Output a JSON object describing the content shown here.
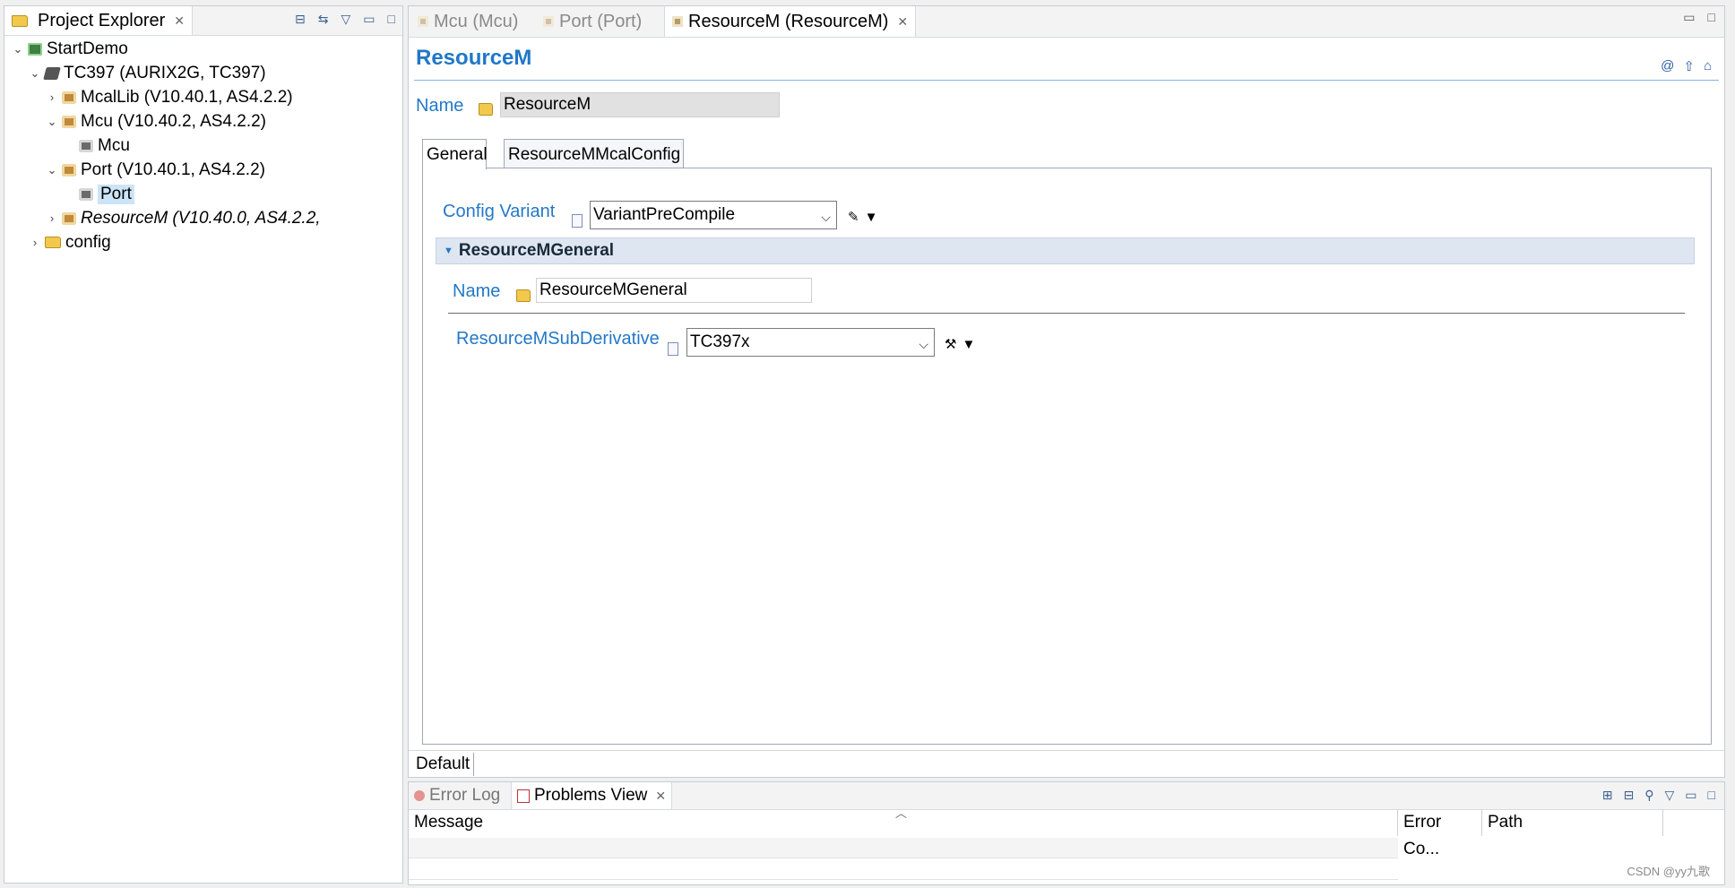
{
  "explorer": {
    "tab_title": "Project Explorer",
    "tree": [
      {
        "label": "StartDemo",
        "level": 0,
        "expanded": true,
        "icon": "project-icon"
      },
      {
        "label": "TC397 (AURIX2G, TC397)",
        "level": 1,
        "expanded": true,
        "icon": "ecu-icon"
      },
      {
        "label": "McalLib (V10.40.1, AS4.2.2)",
        "level": 2,
        "expanded": false,
        "icon": "module-icon"
      },
      {
        "label": "Mcu (V10.40.2, AS4.2.2)",
        "level": 2,
        "expanded": true,
        "icon": "module-icon"
      },
      {
        "label": "Mcu",
        "level": 3,
        "icon": "config-icon"
      },
      {
        "label": "Port (V10.40.1, AS4.2.2)",
        "level": 2,
        "expanded": true,
        "icon": "module-icon"
      },
      {
        "label": "Port",
        "level": 3,
        "icon": "config-icon",
        "selected": true
      },
      {
        "label": "ResourceM (V10.40.0, AS4.2.2,",
        "level": 2,
        "expanded": false,
        "icon": "module-icon",
        "italic": true
      },
      {
        "label": "config",
        "level": 1,
        "expanded": false,
        "icon": "folder-icon"
      }
    ]
  },
  "editor": {
    "tabs": [
      {
        "label": "Mcu (Mcu)",
        "active": false
      },
      {
        "label": "Port (Port)",
        "active": false
      },
      {
        "label": "ResourceM (ResourceM)",
        "active": true
      }
    ],
    "title": "ResourceM",
    "name_label": "Name",
    "name_value": "ResourceM",
    "inner_tabs": [
      "General",
      "ResourceMMcalConfig"
    ],
    "config_variant_label": "Config Variant",
    "config_variant_value": "VariantPreCompile",
    "section_title": "ResourceMGeneral",
    "section_name_label": "Name",
    "section_name_value": "ResourceMGeneral",
    "subderivative_label": "ResourceMSubDerivative",
    "subderivative_value": "TC397x",
    "bottom_tab": "Default"
  },
  "bottom_panel": {
    "tabs": [
      {
        "label": "Error Log",
        "active": false
      },
      {
        "label": "Problems View",
        "active": true
      }
    ],
    "columns": [
      "Message",
      "Error Co...",
      "Path"
    ]
  },
  "watermark": "CSDN @yy九歌"
}
